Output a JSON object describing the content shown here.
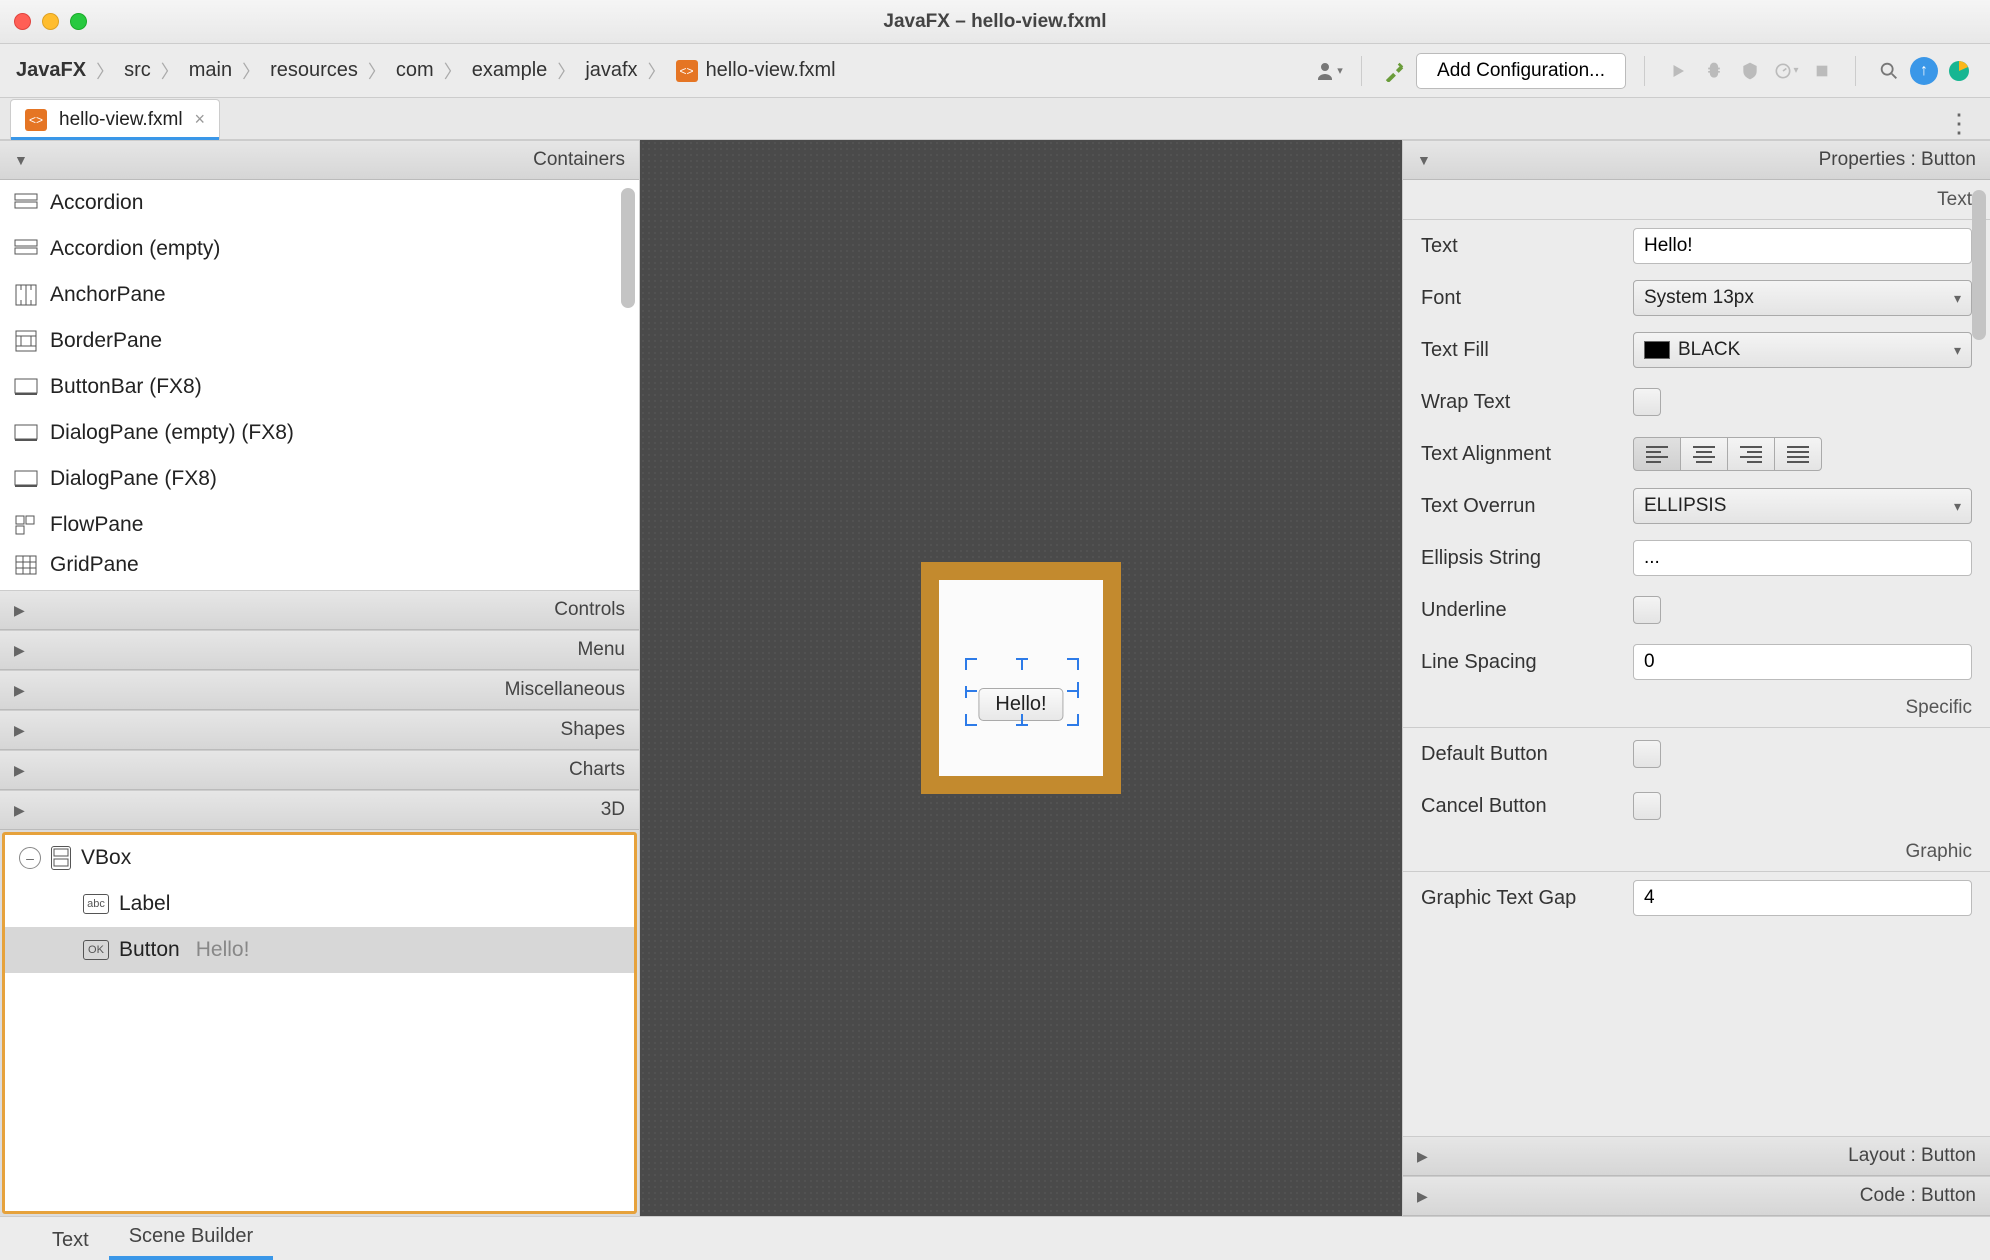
{
  "window": {
    "title": "JavaFX – hello-view.fxml"
  },
  "breadcrumb": [
    "JavaFX",
    "src",
    "main",
    "resources",
    "com",
    "example",
    "javafx",
    "hello-view.fxml"
  ],
  "toolbar": {
    "config_label": "Add Configuration..."
  },
  "tab": {
    "filename": "hello-view.fxml"
  },
  "left": {
    "sections": [
      "Containers",
      "Controls",
      "Menu",
      "Miscellaneous",
      "Shapes",
      "Charts",
      "3D"
    ],
    "containers": [
      "Accordion",
      "Accordion  (empty)",
      "AnchorPane",
      "BorderPane",
      "ButtonBar  (FX8)",
      "DialogPane (empty)  (FX8)",
      "DialogPane  (FX8)",
      "FlowPane",
      "GridPane"
    ],
    "hierarchy": {
      "root": "VBox",
      "children": [
        {
          "type": "Label",
          "text": ""
        },
        {
          "type": "Button",
          "text": "Hello!"
        }
      ]
    }
  },
  "canvas": {
    "button_text": "Hello!"
  },
  "right": {
    "panel_title": "Properties : Button",
    "sections": {
      "text_header": "Text",
      "specific_header": "Specific",
      "graphic_header": "Graphic"
    },
    "labels": {
      "text": "Text",
      "font": "Font",
      "textfill": "Text Fill",
      "wraptext": "Wrap Text",
      "textalign": "Text Alignment",
      "overrun": "Text Overrun",
      "ellipsis": "Ellipsis String",
      "underline": "Underline",
      "linespacing": "Line Spacing",
      "defaultbtn": "Default Button",
      "cancelbtn": "Cancel Button",
      "graphicgap": "Graphic Text Gap"
    },
    "values": {
      "text": "Hello!",
      "font": "System 13px",
      "textfill": "BLACK",
      "overrun": "ELLIPSIS",
      "ellipsis": "...",
      "linespacing": "0",
      "graphicgap": "4"
    },
    "footer_sections": {
      "layout": "Layout : Button",
      "code": "Code : Button"
    }
  },
  "footer": {
    "tab_text": "Text",
    "tab_sb": "Scene Builder"
  }
}
